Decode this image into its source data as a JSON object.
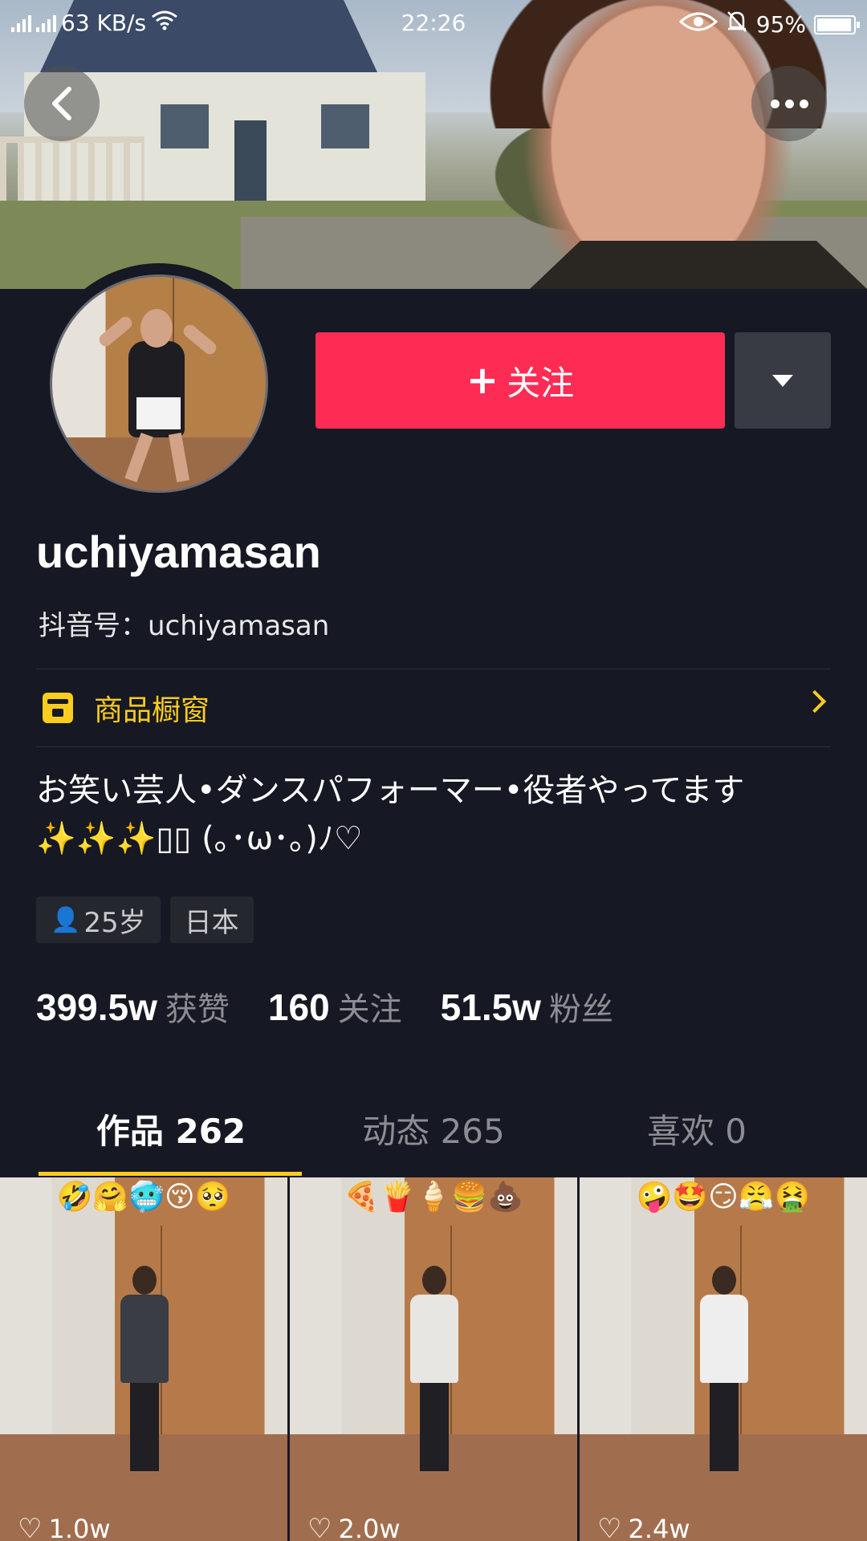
{
  "status_bar": {
    "network_speed": "63 KB/s",
    "time": "22:26",
    "battery": "95%",
    "battery_level": 0.95
  },
  "header": {
    "follow_label": "关注",
    "follow_plus": "+"
  },
  "profile": {
    "nickname": "uchiyamasan",
    "douyin_id": "抖音号：uchiyamasan",
    "shop_label": "商品橱窗",
    "bio": "お笑い芸人•ダンスパフォーマー•役者やってます✨✨✨▯▯ (｡･ω･｡)ﾉ♡",
    "tags": {
      "age": "25岁",
      "region": "日本"
    },
    "stats": [
      {
        "value": "399.5w",
        "label": "获赞"
      },
      {
        "value": "160",
        "label": "关注"
      },
      {
        "value": "51.5w",
        "label": "粉丝"
      }
    ]
  },
  "tabs": [
    {
      "label": "作品 262",
      "active": true
    },
    {
      "label": "动态 265",
      "active": false
    },
    {
      "label": "喜欢 0",
      "active": false
    }
  ],
  "videos": [
    {
      "emojis": "🤣🤗🥶😚🥺",
      "likes": "1.0w",
      "outfit_color": "#3a3d44"
    },
    {
      "emojis": "🍕🍟🍦🍔💩",
      "likes": "2.0w",
      "outfit_color": "#e8e6e2"
    },
    {
      "emojis": "🤪🤩😏😤🤮",
      "likes": "2.4w",
      "outfit_color": "#eeeeee"
    }
  ],
  "colors": {
    "background": "#161823",
    "accent_follow": "#fe2c55",
    "shop_yellow": "#facc1f",
    "tab_indicator": "#facc1f"
  }
}
